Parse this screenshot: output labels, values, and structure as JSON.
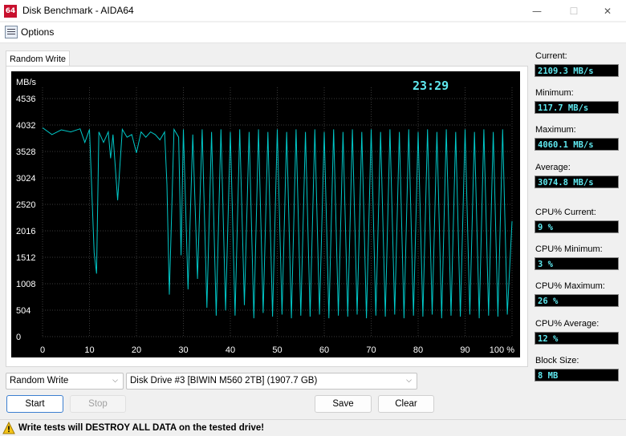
{
  "window": {
    "app_icon": "64",
    "title": "Disk Benchmark - AIDA64",
    "minimize": "—",
    "maximize": "☐",
    "close": "✕"
  },
  "menu": {
    "options_label": "Options"
  },
  "tab": {
    "label": "Random Write"
  },
  "chart_data": {
    "type": "line",
    "ylabel": "MB/s",
    "ylim": [
      0,
      4536
    ],
    "yticks": [
      "4536",
      "4032",
      "3528",
      "3024",
      "2520",
      "2016",
      "1512",
      "1008",
      "504",
      "0"
    ],
    "xlim": [
      0,
      100
    ],
    "xticks": [
      "0",
      "10",
      "20",
      "30",
      "40",
      "50",
      "60",
      "70",
      "80",
      "90",
      "100 %"
    ],
    "timer": "23:29",
    "line_color": "#00c8c8",
    "grid": true,
    "series": [
      {
        "x": [
          0,
          2,
          4,
          6,
          8,
          9,
          10,
          11,
          11.5,
          12,
          13,
          14,
          14.5,
          15,
          16,
          17,
          18,
          19,
          20,
          21,
          22,
          23,
          24,
          25,
          26,
          26.5,
          27,
          28,
          29,
          29.5,
          30,
          31,
          32,
          33,
          34,
          35,
          36,
          37,
          38,
          39,
          40,
          41,
          42,
          43,
          44,
          45,
          46,
          47,
          48,
          49,
          50,
          51,
          52,
          53,
          54,
          55,
          56,
          57,
          58,
          59,
          60,
          61,
          62,
          63,
          64,
          65,
          66,
          67,
          68,
          69,
          70,
          71,
          72,
          73,
          74,
          75,
          76,
          77,
          78,
          79,
          80,
          81,
          82,
          83,
          84,
          85,
          86,
          87,
          88,
          89,
          90,
          91,
          92,
          93,
          94,
          95,
          96,
          97,
          98,
          99,
          100
        ],
        "y": [
          3980,
          3850,
          3940,
          3900,
          3960,
          3700,
          3950,
          1600,
          1200,
          3900,
          3700,
          3900,
          3400,
          3850,
          2600,
          3950,
          3800,
          3850,
          3500,
          3900,
          3800,
          3900,
          3850,
          3750,
          3900,
          2900,
          800,
          3950,
          3800,
          1550,
          3950,
          900,
          3850,
          1100,
          3950,
          550,
          3900,
          400,
          3950,
          500,
          3900,
          400,
          3950,
          600,
          3900,
          350,
          3950,
          450,
          3900,
          380,
          3950,
          420,
          3900,
          350,
          3950,
          400,
          3900,
          380,
          3950,
          420,
          3900,
          350,
          3950,
          400,
          3900,
          380,
          3950,
          420,
          3900,
          350,
          3950,
          400,
          3900,
          380,
          3950,
          420,
          3900,
          350,
          3950,
          400,
          3900,
          380,
          3950,
          420,
          3900,
          350,
          3950,
          400,
          3900,
          380,
          3950,
          420,
          3900,
          350,
          3950,
          400,
          3900,
          380,
          3950,
          420,
          2200
        ]
      }
    ]
  },
  "stats": [
    {
      "label": "Current:",
      "value": "2109.3 MB/s"
    },
    {
      "label": "Minimum:",
      "value": "117.7 MB/s"
    },
    {
      "label": "Maximum:",
      "value": "4060.1 MB/s"
    },
    {
      "label": "Average:",
      "value": "3074.8 MB/s"
    },
    {
      "label": "CPU% Current:",
      "value": "9 %"
    },
    {
      "label": "CPU% Minimum:",
      "value": "3 %"
    },
    {
      "label": "CPU% Maximum:",
      "value": "26 %"
    },
    {
      "label": "CPU% Average:",
      "value": "12 %"
    },
    {
      "label": "Block Size:",
      "value": "8 MB"
    }
  ],
  "controls": {
    "test_select": "Random Write",
    "drive_select": "Disk Drive #3  [BIWIN M560 2TB]  (1907.7 GB)",
    "start": "Start",
    "stop": "Stop",
    "save": "Save",
    "clear": "Clear"
  },
  "status": {
    "warning": "Write tests will DESTROY ALL DATA on the tested drive!"
  }
}
